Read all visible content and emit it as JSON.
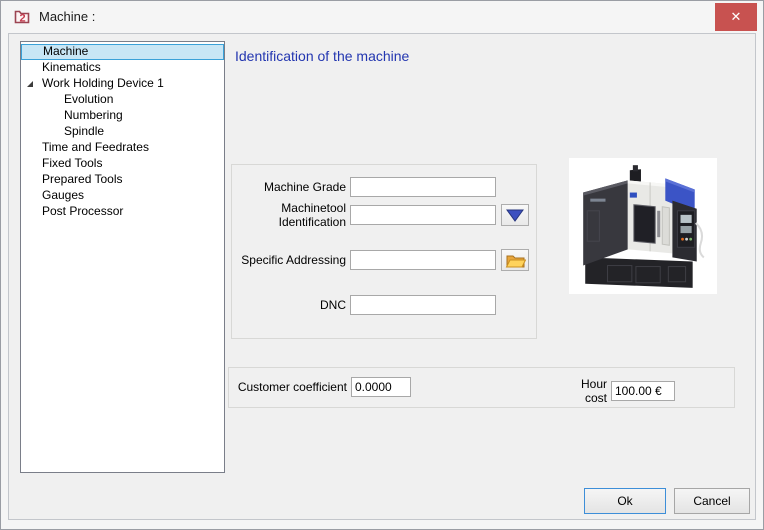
{
  "window": {
    "title": "Machine :",
    "close_glyph": "✕"
  },
  "tree": {
    "items": [
      {
        "label": "Machine",
        "level": 0,
        "selected": true
      },
      {
        "label": "Kinematics",
        "level": 0
      },
      {
        "label": "Work Holding Device 1",
        "level": 0,
        "expanded": true
      },
      {
        "label": "Evolution",
        "level": 1
      },
      {
        "label": "Numbering",
        "level": 1
      },
      {
        "label": "Spindle",
        "level": 1
      },
      {
        "label": "Time and Feedrates",
        "level": 0
      },
      {
        "label": "Fixed Tools",
        "level": 0
      },
      {
        "label": "Prepared Tools",
        "level": 0
      },
      {
        "label": "Gauges",
        "level": 0
      },
      {
        "label": "Post Processor",
        "level": 0
      }
    ]
  },
  "main": {
    "heading": "Identification of the machine",
    "identification": {
      "machine_grade_label": "Machine Grade",
      "machine_grade_value": "",
      "machinetool_identification_label": "Machinetool Identification",
      "machinetool_identification_value": "",
      "specific_addressing_label": "Specific Addressing",
      "specific_addressing_value": "",
      "dnc_label": "DNC",
      "dnc_value": ""
    },
    "costs": {
      "customer_coefficient_label": "Customer coefficient",
      "customer_coefficient_value": "0.0000",
      "hour_cost_label": "Hour cost",
      "hour_cost_value": "100.00 €"
    }
  },
  "footer": {
    "ok_label": "Ok",
    "cancel_label": "Cancel"
  },
  "icons": {
    "app": "app-logo-2-icon",
    "close": "close-icon",
    "expander": "tree-expanded-triangle-icon",
    "dropdown": "blue-down-arrow-icon",
    "browse": "open-folder-icon",
    "photo": "cnc-machine-photo"
  },
  "colors": {
    "heading_blue": "#2336b0",
    "selection_fill": "#c8e6f5",
    "selection_border": "#3aa1d8",
    "close_red": "#c85250",
    "dropdown_blue": "#3c50c0",
    "folder_yellow": "#f7c843",
    "ok_border_blue": "#3d8ed8",
    "machine_blue": "#3b54c6"
  }
}
